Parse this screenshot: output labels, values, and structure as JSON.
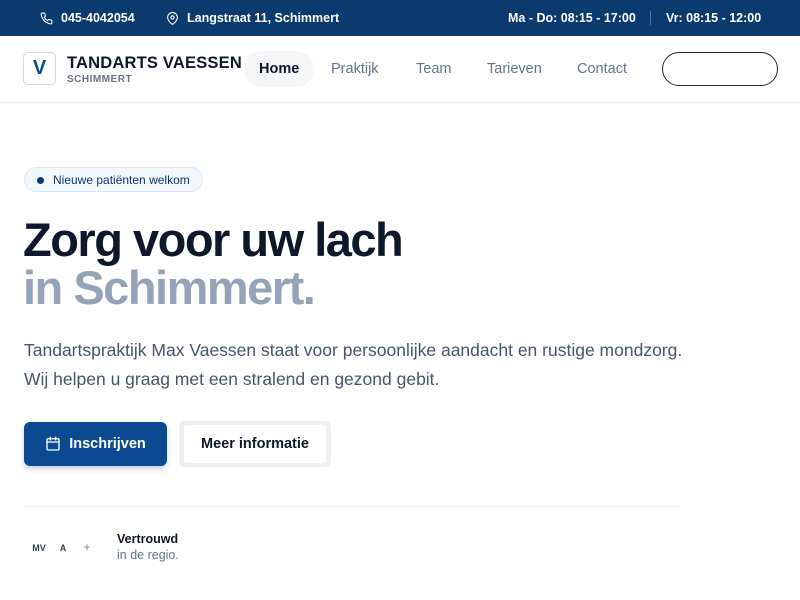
{
  "topbar": {
    "phone": "045-4042054",
    "address": "Langstraat 11, Schimmert",
    "hours_weekdays": "Ma - Do: 08:15 - 17:00",
    "hours_friday": "Vr: 08:15 - 12:00",
    "phone_icon": "phone-icon",
    "address_icon": "location-pin-icon"
  },
  "header": {
    "logo_letter": "V",
    "brand_name": "TANDARTS VAESSEN",
    "brand_sub": "SCHIMMERT",
    "nav": [
      "Home",
      "Praktijk",
      "Team",
      "Tarieven",
      "Contact"
    ],
    "active_nav": "Home",
    "cta_label": ""
  },
  "hero": {
    "badge": "Nieuwe patiënten welkom",
    "title_line1": "Zorg voor uw lach",
    "title_line2": "in Schimmert.",
    "text": "Tandartspraktijk Max Vaessen staat voor persoonlijke aandacht en rustige mondzorg. Wij helpen u graag met een stralend en gezond gebit.",
    "primary_button": "Inschrijven",
    "primary_button_icon": "calendar-icon",
    "secondary_button": "Meer informatie"
  },
  "trust": {
    "avatars": [
      "MV",
      "A",
      "+"
    ],
    "title": "Vertrouwd",
    "subtitle": "in de regio."
  },
  "colors": {
    "topbar_bg": "#0b3a6e",
    "primary": "#0b4a91",
    "title_muted": "#94a3b8",
    "text": "#475569"
  }
}
